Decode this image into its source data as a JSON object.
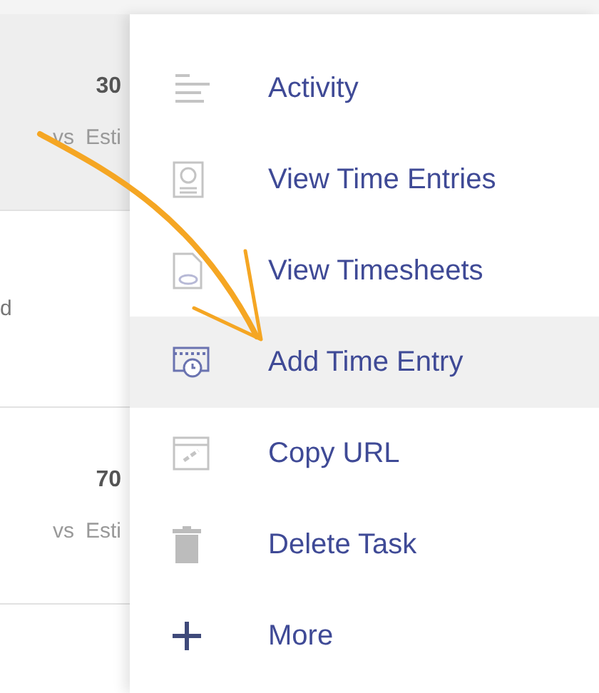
{
  "task_rows": [
    {
      "hours": "30",
      "compare": "vs",
      "label": "Esti",
      "shaded": true
    },
    {
      "status": "d",
      "shaded": false
    },
    {
      "hours": "70",
      "compare": "vs",
      "label": "Esti",
      "shaded": false
    }
  ],
  "menu": [
    {
      "label": "Activity",
      "kind": "lines",
      "selected": false
    },
    {
      "label": "View Time Entries",
      "kind": "entries",
      "selected": false
    },
    {
      "label": "View Timesheets",
      "kind": "sheets",
      "selected": false
    },
    {
      "label": "Add Time Entry",
      "kind": "calendar",
      "selected": true
    },
    {
      "label": "Copy URL",
      "kind": "link",
      "selected": false
    },
    {
      "label": "Delete Task",
      "kind": "trash",
      "selected": false
    },
    {
      "label": "More",
      "kind": "plus",
      "selected": false
    }
  ]
}
